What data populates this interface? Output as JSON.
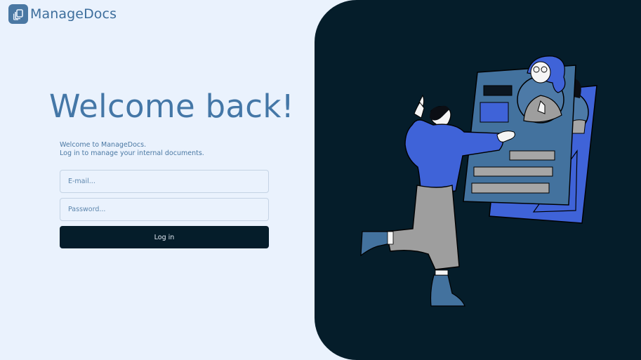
{
  "brand": {
    "name": "ManageDocs",
    "logo_icon": "documents-icon"
  },
  "main": {
    "title": "Welcome back!",
    "intro_line1": "Welcome to ManageDocs.",
    "intro_line2": "Log in to manage your internal documents."
  },
  "form": {
    "email_placeholder": "E-mail...",
    "password_placeholder": "Password...",
    "login_label": "Log in"
  },
  "colors": {
    "background": "#eaf2fd",
    "accent": "#4477a7",
    "dark_panel": "#051d2a",
    "illustration_blue": "#3f63d8",
    "illustration_steel": "#43729e"
  }
}
